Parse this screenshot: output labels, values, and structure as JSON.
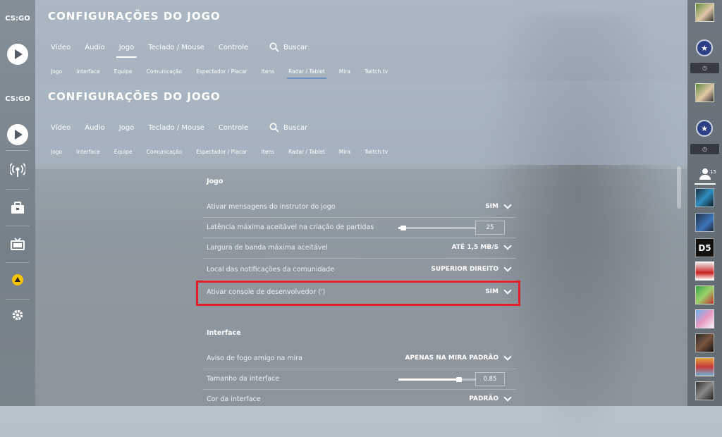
{
  "app": {
    "logo_text": "CS:GO"
  },
  "header": {
    "title": "CONFIGURAÇÕES DO JOGO",
    "tabs": [
      "Vídeo",
      "Áudio",
      "Jogo",
      "Teclado / Mouse",
      "Controle"
    ],
    "active_tab": "Jogo",
    "search_label": "Buscar",
    "subtabs": [
      "Jogo",
      "Interface",
      "Equipe",
      "Comunicação",
      "Espectador / Placar",
      "Itens",
      "Radar / Tablet",
      "Mira",
      "Twitch.tv"
    ],
    "active_subtab": "Radar / Tablet"
  },
  "settings": {
    "section_jogo": "Jogo",
    "rows_jogo": [
      {
        "label": "Ativar mensagens do instrutor do jogo",
        "value": "SIM"
      },
      {
        "label": "Latência máxima aceitável na criação de partidas",
        "value": "25",
        "slider_fraction": 0.08
      },
      {
        "label": "Largura de banda máxima aceitável",
        "value": "ATÉ 1,5 MB/S"
      },
      {
        "label": "Local das notificações da comunidade",
        "value": "SUPERIOR DIREITO"
      },
      {
        "label": "Ativar console de desenvolvedor (')",
        "value": "SIM"
      }
    ],
    "section_interface": "Interface",
    "rows_interface": [
      {
        "label": "Aviso de fogo amigo na mira",
        "value": "APENAS NA MIRA PADRÃO"
      },
      {
        "label": "Tamanho da interface",
        "value": "0.85",
        "slider_fraction": 0.78
      },
      {
        "label": "Cor da interface",
        "value": "PADRÃO"
      }
    ]
  },
  "right_sidebar": {
    "friends_count": "15"
  },
  "colors": {
    "highlight": "#e11f2a",
    "accent_tab": "#6a93c0"
  }
}
